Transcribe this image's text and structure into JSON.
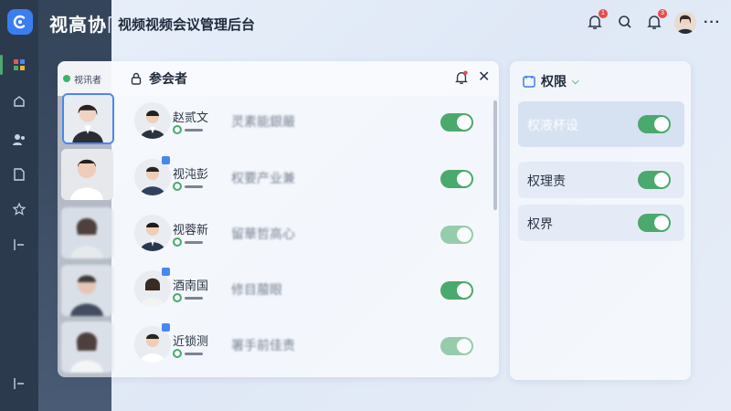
{
  "app": {
    "title_bold": "视高协",
    "title_light": "同",
    "subtitle": "视频视频会议管理后台"
  },
  "topbar": {
    "bell_badge_1": "1",
    "bell_badge_2": "3",
    "more": "···"
  },
  "panel": {
    "viewer_tab": "视讯者",
    "title": "参会者"
  },
  "participants": [
    {
      "name": "赵贰文",
      "role": "灵素能銀嚴",
      "enabled": true
    },
    {
      "name": "视沌彭",
      "role": "权要产业兼",
      "enabled": true
    },
    {
      "name": "视蓉新",
      "role": "留華哲高心",
      "enabled": true
    },
    {
      "name": "酒南国",
      "role": "修目菔眼",
      "enabled": true
    },
    {
      "name": "近锁测",
      "role": "署手前佳责",
      "enabled": true
    }
  ],
  "permissions": {
    "title": "权限",
    "items": [
      {
        "label": "权液杯设",
        "enabled": true
      },
      {
        "label": "权理责",
        "enabled": true
      },
      {
        "label": "权界",
        "enabled": true
      }
    ]
  },
  "colors": {
    "accent_green": "#4aa96c",
    "brand_blue": "#3b7ef0",
    "rail_dark": "#2c3a4e"
  }
}
